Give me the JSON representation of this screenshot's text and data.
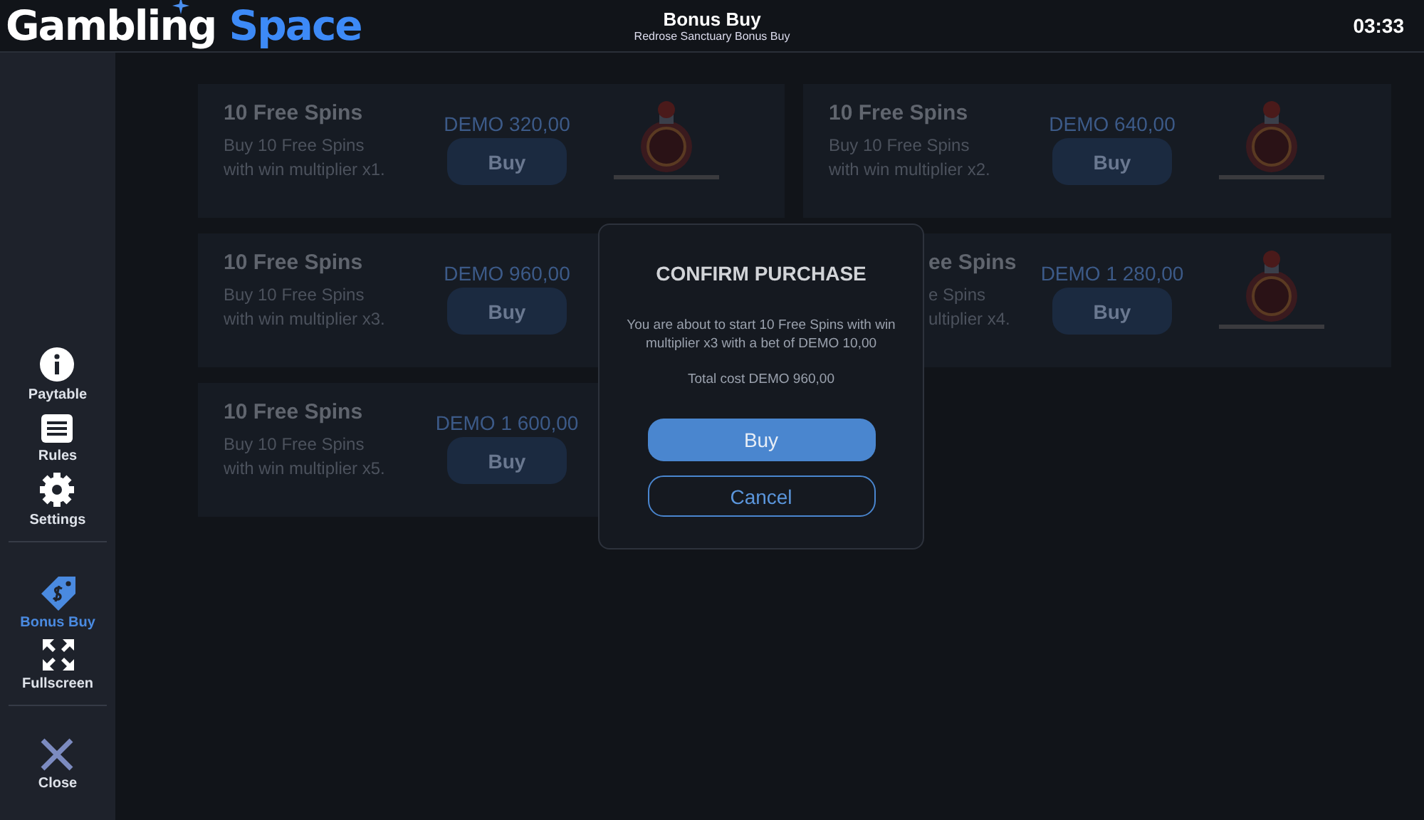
{
  "header": {
    "logo": {
      "first": "Gambling",
      "second": "Space"
    },
    "title": "Bonus Buy",
    "subtitle": "Redrose Sanctuary Bonus Buy",
    "clock": "03:33"
  },
  "sidebar": {
    "groups": [
      [
        {
          "label": "Paytable",
          "selected": false
        },
        {
          "label": "Rules",
          "selected": false
        },
        {
          "label": "Settings",
          "selected": false
        }
      ],
      [
        {
          "label": "Bonus Buy",
          "selected": true
        },
        {
          "label": "Fullscreen",
          "selected": false
        }
      ],
      [
        {
          "label": "Close",
          "selected": false
        }
      ]
    ]
  },
  "offers": [
    {
      "title": "10 Free Spins",
      "description": [
        "Buy 10 Free Spins",
        "with win multiplier x1."
      ],
      "price": "DEMO 320,00",
      "button": "Buy",
      "covered": false
    },
    {
      "title": "10 Free Spins",
      "description": [
        "Buy 10 Free Spins",
        "with win multiplier x2."
      ],
      "price": "DEMO 640,00",
      "button": "Buy",
      "covered": false
    },
    {
      "title": "10 Free Spins",
      "description": [
        "Buy 10 Free Spins",
        "with win multiplier x3."
      ],
      "price": "DEMO 960,00",
      "button": "Buy",
      "covered": false
    },
    {
      "title": "ee Spins",
      "description": [
        "e Spins",
        "ultiplier x4."
      ],
      "price": "DEMO 1 280,00",
      "button": "Buy",
      "covered": true
    },
    {
      "title": "10 Free Spins",
      "description": [
        "Buy 10 Free Spins",
        "with win multiplier x5."
      ],
      "price": "DEMO 1 600,00",
      "button": "Buy",
      "covered": false
    }
  ],
  "dialog": {
    "title": "CONFIRM PURCHASE",
    "message": "You are about to start 10 Free Spins with win multiplier x3 with a bet of DEMO 10,00",
    "total": "Total cost DEMO 960,00",
    "confirm": "Buy",
    "cancel": "Cancel"
  }
}
